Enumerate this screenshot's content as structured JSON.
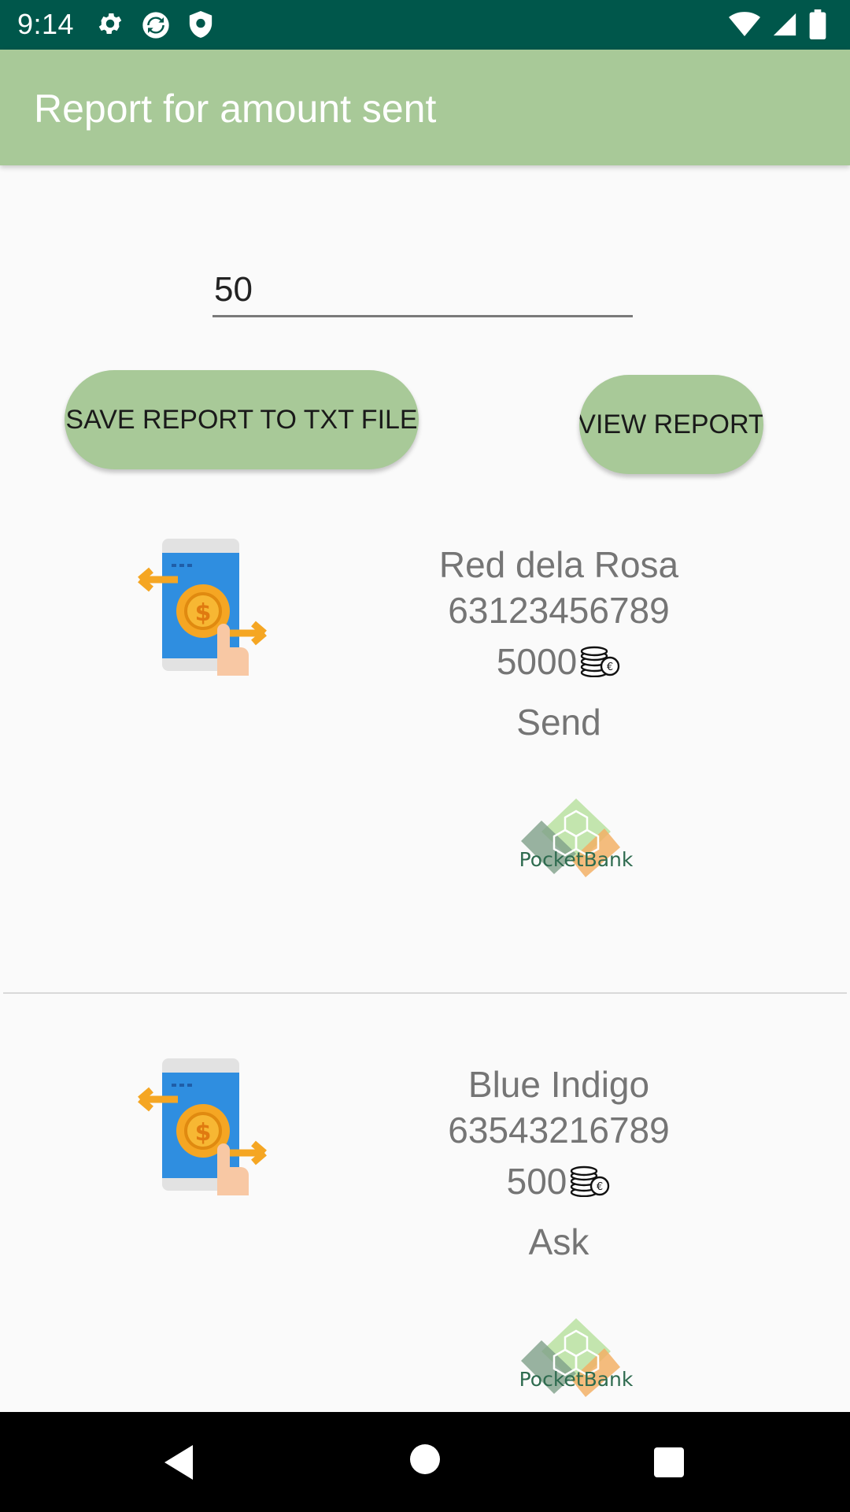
{
  "status_bar": {
    "time": "9:14"
  },
  "app_bar": {
    "title": "Report for amount sent"
  },
  "amount_field": {
    "value": "50"
  },
  "buttons": {
    "save": "SAVE REPORT TO TXT FILE",
    "view": "VIEW REPORT"
  },
  "transactions": [
    {
      "name": "Red dela Rosa",
      "phone": "63123456789",
      "amount": "5000",
      "type": "Send"
    },
    {
      "name": "Blue Indigo",
      "phone": "63543216789",
      "amount": "500",
      "type": "Ask"
    }
  ],
  "bank_logo_text": "PocketBank",
  "colors": {
    "status_bar": "#00574b",
    "app_bar": "#a8c998",
    "accent_orange": "#f5a623",
    "phone_blue": "#2f8ee0"
  }
}
